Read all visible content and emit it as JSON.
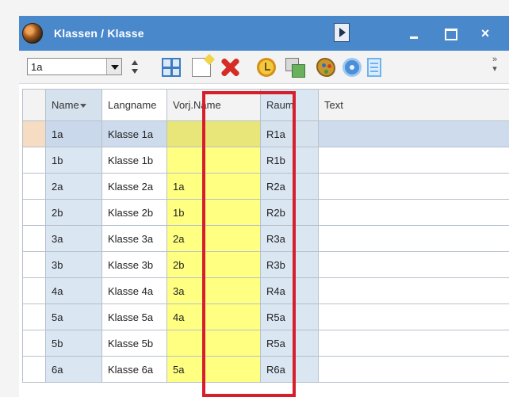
{
  "window": {
    "title": "Klassen / Klasse"
  },
  "toolbar": {
    "selected_class": "1a",
    "overflow_label": "»"
  },
  "grid": {
    "columns": [
      "Name",
      "Langname",
      "Vorj.Name",
      "Raum",
      "Text"
    ],
    "rows": [
      {
        "name": "1a",
        "langname": "Klasse 1a",
        "vorjahr": "",
        "raum": "R1a",
        "text": ""
      },
      {
        "name": "1b",
        "langname": "Klasse 1b",
        "vorjahr": "",
        "raum": "R1b",
        "text": ""
      },
      {
        "name": "2a",
        "langname": "Klasse 2a",
        "vorjahr": "1a",
        "raum": "R2a",
        "text": ""
      },
      {
        "name": "2b",
        "langname": "Klasse 2b",
        "vorjahr": "1b",
        "raum": "R2b",
        "text": ""
      },
      {
        "name": "3a",
        "langname": "Klasse 3a",
        "vorjahr": "2a",
        "raum": "R3a",
        "text": ""
      },
      {
        "name": "3b",
        "langname": "Klasse 3b",
        "vorjahr": "2b",
        "raum": "R3b",
        "text": ""
      },
      {
        "name": "4a",
        "langname": "Klasse 4a",
        "vorjahr": "3a",
        "raum": "R4a",
        "text": ""
      },
      {
        "name": "5a",
        "langname": "Klasse 5a",
        "vorjahr": "4a",
        "raum": "R5a",
        "text": ""
      },
      {
        "name": "5b",
        "langname": "Klasse 5b",
        "vorjahr": "",
        "raum": "R5a",
        "text": ""
      },
      {
        "name": "6a",
        "langname": "Klasse 6a",
        "vorjahr": "5a",
        "raum": "R6a",
        "text": ""
      }
    ]
  },
  "colors": {
    "titlebar": "#4a88cc",
    "highlight": "#d61f2a",
    "previous_year_column": "#ffff82"
  }
}
